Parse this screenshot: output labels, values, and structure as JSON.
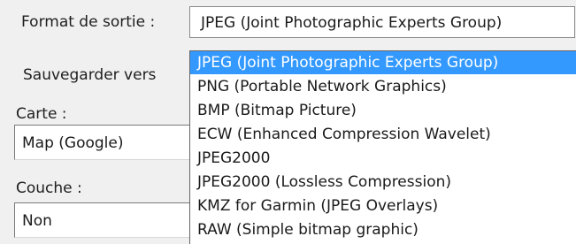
{
  "labels": {
    "format_de_sortie": "Format de sortie :",
    "sauvegarder_vers": "Sauvegarder vers",
    "carte": "Carte :",
    "couche": "Couche :"
  },
  "format_select": {
    "selected_value": "JPEG (Joint Photographic Experts Group)",
    "options": [
      "JPEG (Joint Photographic Experts Group)",
      "PNG (Portable Network Graphics)",
      "BMP (Bitmap Picture)",
      "ECW (Enhanced Compression Wavelet)",
      "JPEG2000",
      "JPEG2000 (Lossless Compression)",
      "KMZ for Garmin (JPEG Overlays)",
      "RAW (Simple bitmap graphic)"
    ],
    "highlighted_index": 0
  },
  "carte_field": {
    "value": "Map (Google)"
  },
  "couche_field": {
    "value": "Non"
  },
  "colors": {
    "window_bg": "#f0f0f0",
    "selection_bg": "#3399ff",
    "selection_text": "#ffffff"
  }
}
